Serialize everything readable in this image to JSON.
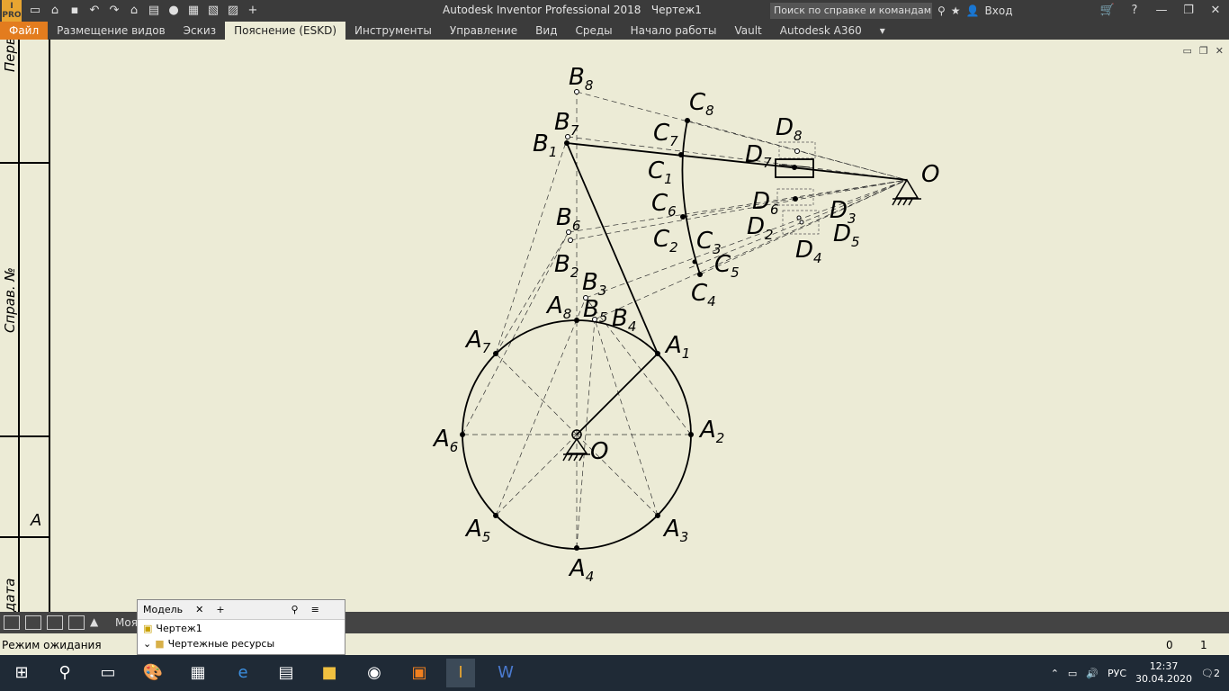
{
  "app": {
    "title": "Autodesk Inventor Professional 2018",
    "document": "Чертеж1",
    "logo_text": "I PRO",
    "search_placeholder": "Поиск по справке и командам...",
    "signin": "Вход"
  },
  "ribbon": {
    "tabs": [
      "Файл",
      "Размещение видов",
      "Эскиз",
      "Пояснение (ESKD)",
      "Инструменты",
      "Управление",
      "Вид",
      "Среды",
      "Начало работы",
      "Vault",
      "Autodesk A360"
    ],
    "active_tab": "Пояснение (ESKD)"
  },
  "stamp": {
    "top_text": "Перв",
    "middle_text": "Справ. №",
    "letter": "A",
    "bottom_text": "дата"
  },
  "drawing_labels": {
    "A1": [
      "A",
      "1"
    ],
    "A2": [
      "A",
      "2"
    ],
    "A3": [
      "A",
      "3"
    ],
    "A4": [
      "A",
      "4"
    ],
    "A5": [
      "A",
      "5"
    ],
    "A6": [
      "A",
      "6"
    ],
    "A7": [
      "A",
      "7"
    ],
    "A8": [
      "A",
      "8"
    ],
    "B1": [
      "B",
      "1"
    ],
    "B2": [
      "B",
      "2"
    ],
    "B3": [
      "B",
      "3"
    ],
    "B4": [
      "B",
      "4"
    ],
    "B5": [
      "B",
      "5"
    ],
    "B6": [
      "B",
      "6"
    ],
    "B7": [
      "B",
      "7"
    ],
    "B8": [
      "B",
      "8"
    ],
    "C1": [
      "C",
      "1"
    ],
    "C2": [
      "C",
      "2"
    ],
    "C3": [
      "C",
      "3"
    ],
    "C4": [
      "C",
      "4"
    ],
    "C5": [
      "C",
      "5"
    ],
    "C6": [
      "C",
      "6"
    ],
    "C7": [
      "C",
      "7"
    ],
    "C8": [
      "C",
      "8"
    ],
    "D2": [
      "D",
      "2"
    ],
    "D3": [
      "D",
      "3"
    ],
    "D4": [
      "D",
      "4"
    ],
    "D5": [
      "D",
      "5"
    ],
    "D6": [
      "D",
      "6"
    ],
    "D7": [
      "D",
      "7"
    ],
    "D8": [
      "D",
      "8"
    ],
    "O_center": "O",
    "O_pivot": "O"
  },
  "browser": {
    "tab": "Модель",
    "items": [
      "Чертеж1",
      "Чертежные ресурсы"
    ]
  },
  "status": {
    "text": "Режим ожидания",
    "count1": "0",
    "count2": "1",
    "view_tab": "Моя"
  },
  "taskbar": {
    "lang": "РУС",
    "time": "12:37",
    "date": "30.04.2020",
    "notif": "2"
  }
}
